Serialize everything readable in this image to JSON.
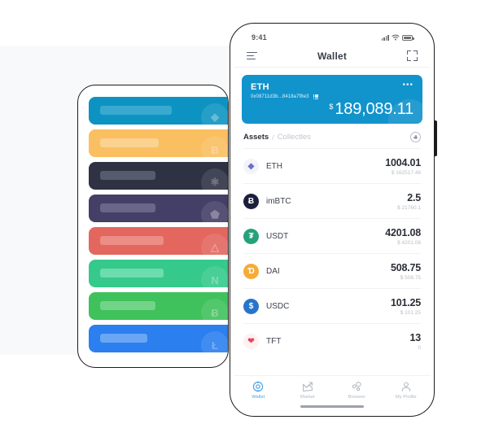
{
  "background": {
    "panel_color": "#f8f9fa",
    "page_color": "#ffffff"
  },
  "left_device": {
    "name": "background-phone-card-stack",
    "cards": [
      {
        "label": "eth-card",
        "color": "#0d93c2",
        "bar_color": "#3aa9d0",
        "glyph": "◆"
      },
      {
        "label": "btc-card",
        "color": "#f9bf61",
        "bar_color": "#fbd28f",
        "glyph": "Ƀ"
      },
      {
        "label": "atom-card",
        "color": "#2e3243",
        "bar_color": "#565b6d",
        "glyph": "⚛"
      },
      {
        "label": "eos-card",
        "color": "#443f66",
        "bar_color": "#6b6589",
        "glyph": "⬟"
      },
      {
        "label": "trx-card",
        "color": "#e3675f",
        "bar_color": "#ec8d86",
        "glyph": "△"
      },
      {
        "label": "neo-card",
        "color": "#36c98c",
        "bar_color": "#6ddcae",
        "glyph": "N"
      },
      {
        "label": "bch-card",
        "color": "#3fc15c",
        "bar_color": "#73d489",
        "glyph": "Ƀ"
      },
      {
        "label": "ltc-card",
        "color": "#2b7fef",
        "bar_color": "#6aa6f4",
        "glyph": "Ł"
      }
    ]
  },
  "phone": {
    "status_bar": {
      "time": "9:41",
      "signal_icon": "signal-icon",
      "wifi_icon": "wifi-icon",
      "battery_icon": "battery-icon"
    },
    "nav": {
      "menu_icon": "menu-icon",
      "title": "Wallet",
      "scan_icon": "scan-icon"
    },
    "balance_card": {
      "symbol": "ETH",
      "address": "0x08711d3b...8418a7f8e3",
      "qr_icon": "qr-code-icon",
      "more_icon": "•••",
      "currency_symbol": "$",
      "amount": "189,089.11",
      "color": "#1193cc"
    },
    "tabs": {
      "assets_label": "Assets",
      "separator": "/",
      "collectibles_label": "Collectles",
      "add_icon": "plus-circle-icon"
    },
    "assets": [
      {
        "symbol": "ETH",
        "amount": "1004.01",
        "fiat": "$ 162517.48",
        "icon_color": "#f3f4fb",
        "icon_glyph": "◆",
        "glyph_color": "#6b72c4"
      },
      {
        "symbol": "imBTC",
        "amount": "2.5",
        "fiat": "$ 21760.1",
        "icon_color": "#1b1f3b",
        "icon_glyph": "Ƀ",
        "glyph_color": "#ffffff"
      },
      {
        "symbol": "USDT",
        "amount": "4201.08",
        "fiat": "$ 4201.08",
        "icon_color": "#26a17b",
        "icon_glyph": "₮",
        "glyph_color": "#ffffff"
      },
      {
        "symbol": "DAI",
        "amount": "508.75",
        "fiat": "$ 508.75",
        "icon_color": "#f5ac37",
        "icon_glyph": "Ɗ",
        "glyph_color": "#ffffff"
      },
      {
        "symbol": "USDC",
        "amount": "101.25",
        "fiat": "$ 101.25",
        "icon_color": "#2775ca",
        "icon_glyph": "$",
        "glyph_color": "#ffffff"
      },
      {
        "symbol": "TFT",
        "amount": "13",
        "fiat": "0",
        "icon_color": "#fdf1f2",
        "icon_glyph": "❤",
        "glyph_color": "#e8445a"
      }
    ],
    "tabbar": [
      {
        "label": "Wallet",
        "icon": "wallet-icon",
        "active": true
      },
      {
        "label": "Market",
        "icon": "chart-icon",
        "active": false
      },
      {
        "label": "Browser",
        "icon": "browser-icon",
        "active": false
      },
      {
        "label": "My Profile",
        "icon": "person-icon",
        "active": false
      }
    ],
    "accent_color": "#4da3e8"
  }
}
